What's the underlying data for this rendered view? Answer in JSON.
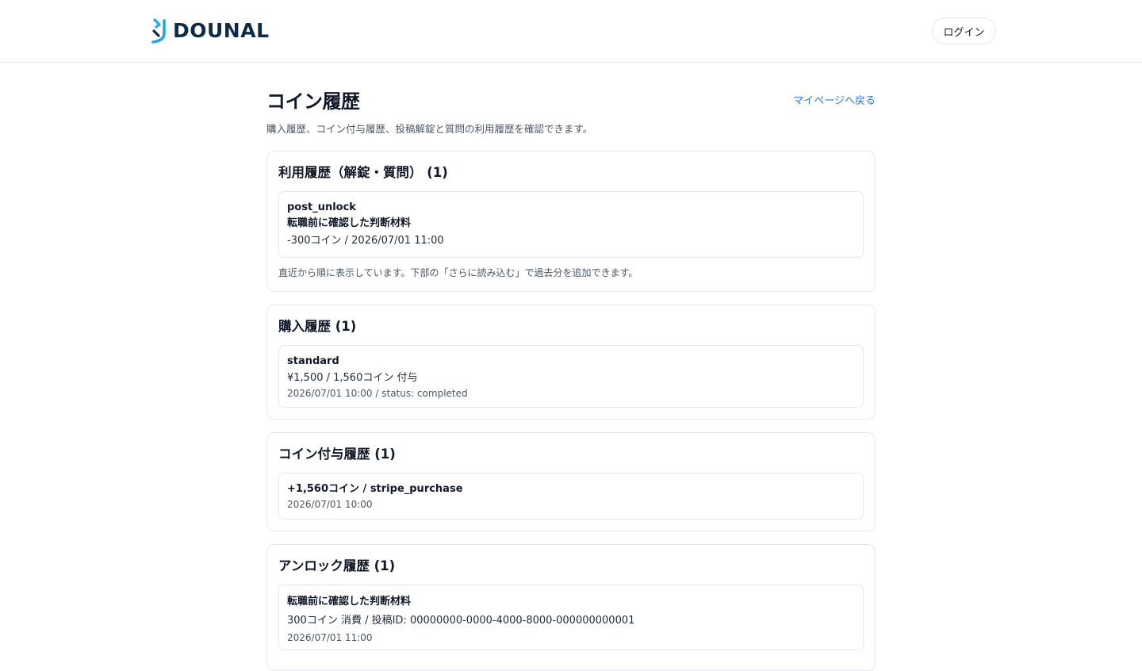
{
  "header": {
    "logo_text": "DOUNAL",
    "login_label": "ログイン"
  },
  "page": {
    "title": "コイン履歴",
    "back_link": "マイページへ戻る",
    "subtitle": "購入履歴、コイン付与履歴、投稿解錠と質問の利用履歴を確認できます。"
  },
  "usage": {
    "title": "利用履歴（解錠・質問） (1)",
    "entries": [
      {
        "type": "post_unlock",
        "name": "転職前に確認した判断材料",
        "detail": "-300コイン / 2026/07/01 11:00"
      }
    ],
    "note": "直近から順に表示しています。下部の「さらに読み込む」で過去分を追加できます。"
  },
  "purchase": {
    "title": "購入履歴 (1)",
    "entries": [
      {
        "plan": "standard",
        "detail": "¥1,500 / 1,560コイン 付与",
        "meta": "2026/07/01 10:00 / status: completed"
      }
    ]
  },
  "grant": {
    "title": "コイン付与履歴 (1)",
    "entries": [
      {
        "summary": "+1,560コイン / stripe_purchase",
        "meta": "2026/07/01 10:00"
      }
    ]
  },
  "unlock": {
    "title": "アンロック履歴 (1)",
    "entries": [
      {
        "name": "転職前に確認した判断材料",
        "detail": "300コイン 消費 / 投稿ID: 00000000-0000-4000-8000-000000000001",
        "meta": "2026/07/01 11:00"
      }
    ]
  },
  "colors": {
    "brand_navy": "#0f2a44",
    "brand_cyan": "#22a6e0",
    "link": "#2b7bd8",
    "border": "#e5e7eb"
  }
}
